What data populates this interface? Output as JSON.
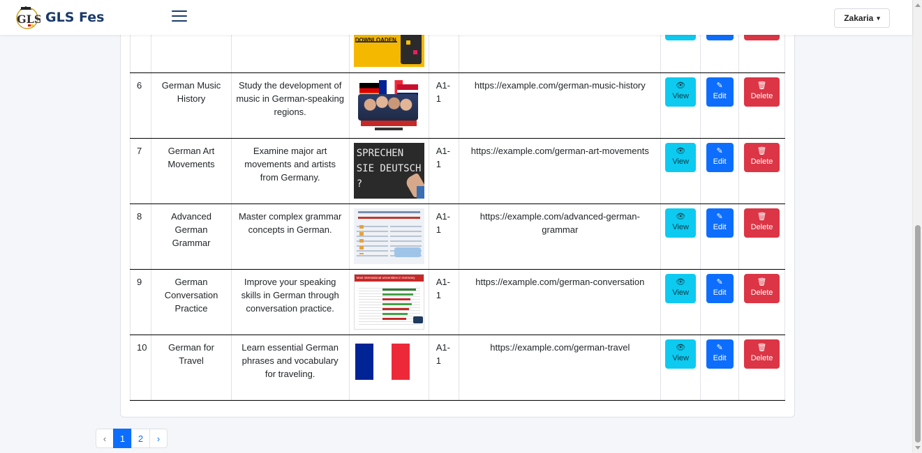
{
  "app": {
    "brand": "GLS Fes",
    "logo_text": "GLS"
  },
  "navbar": {
    "user_name": "Zakaria",
    "user_caret": "⌄"
  },
  "partial_row": {
    "image_caption": "DOWNLOADEN"
  },
  "rows": [
    {
      "id": "6",
      "title": "German Music History",
      "description": "Study the development of music in German-speaking regions.",
      "image": "group-photo",
      "level": "A1-1",
      "url": "https://example.com/german-music-history"
    },
    {
      "id": "7",
      "title": "German Art Movements",
      "description": "Examine major art movements and artists from Germany.",
      "image": "chalkboard",
      "image_text": "SPRECHEN SIE DEUTSCH ?",
      "level": "A1-1",
      "url": "https://example.com/german-art-movements"
    },
    {
      "id": "8",
      "title": "Advanced German Grammar",
      "description": "Master complex grammar concepts in German.",
      "image": "infographic",
      "level": "A1-1",
      "url": "https://example.com/advanced-german-grammar"
    },
    {
      "id": "9",
      "title": "German Conversation Practice",
      "description": "Improve your speaking skills in German through conversation practice.",
      "image": "bar-chart",
      "image_text": "Most international universities in Germany",
      "level": "A1-1",
      "url": "https://example.com/german-conversation"
    },
    {
      "id": "10",
      "title": "German for Travel",
      "description": "Learn essential German phrases and vocabulary for traveling.",
      "image": "french-flag",
      "level": "A1-1",
      "url": "https://example.com/german-travel"
    }
  ],
  "actions": {
    "view": "View",
    "edit": "Edit",
    "delete": "Delete"
  },
  "pagination": {
    "prev": "‹",
    "pages": [
      "1",
      "2"
    ],
    "active_page": "1",
    "next": "›"
  },
  "colors": {
    "brand": "#1a3a6b",
    "view": "#0dcaf0",
    "edit": "#0d6efd",
    "delete": "#dc3545"
  }
}
